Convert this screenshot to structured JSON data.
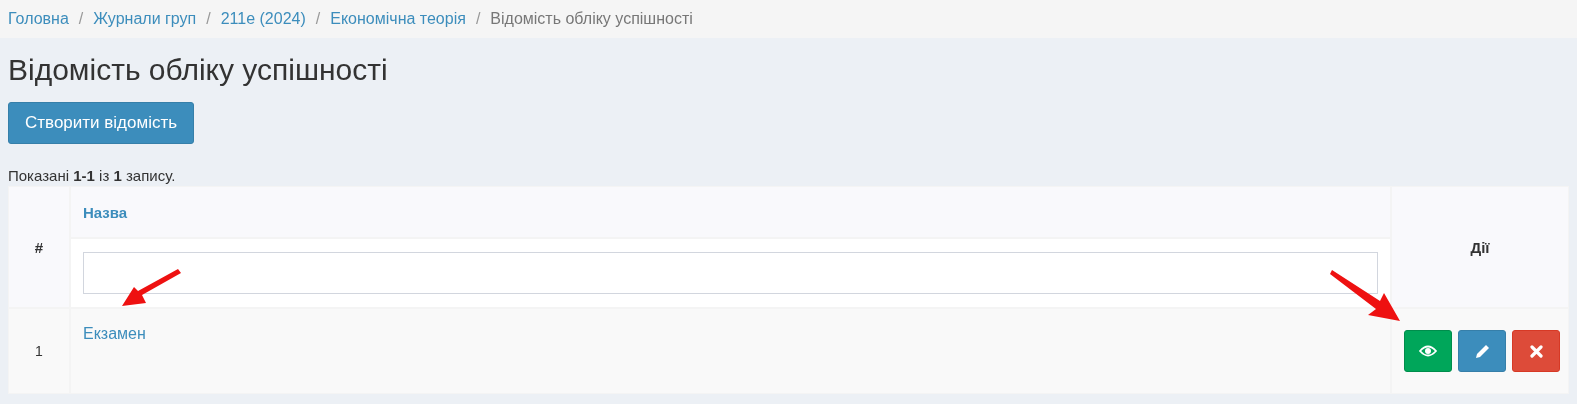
{
  "breadcrumb": [
    {
      "label": "Головна",
      "current": false
    },
    {
      "label": "Журнали груп",
      "current": false
    },
    {
      "label": "211е (2024)",
      "current": false
    },
    {
      "label": "Економічна теорія",
      "current": false
    },
    {
      "label": "Відомість обліку успішності",
      "current": true
    }
  ],
  "breadcrumb_separator": "/",
  "page_title": "Відомість обліку успішності",
  "create_button": "Створити відомість",
  "summary": "Показані **1-1** із **1** запису.",
  "table": {
    "columns": [
      "#",
      "Назва",
      "Дії"
    ],
    "rows": [
      {
        "number": "1",
        "name": "Екзамен",
        "actions": [
          {
            "kind": "view"
          },
          {
            "kind": "edit"
          },
          {
            "kind": "delete"
          }
        ]
      }
    ]
  }
}
